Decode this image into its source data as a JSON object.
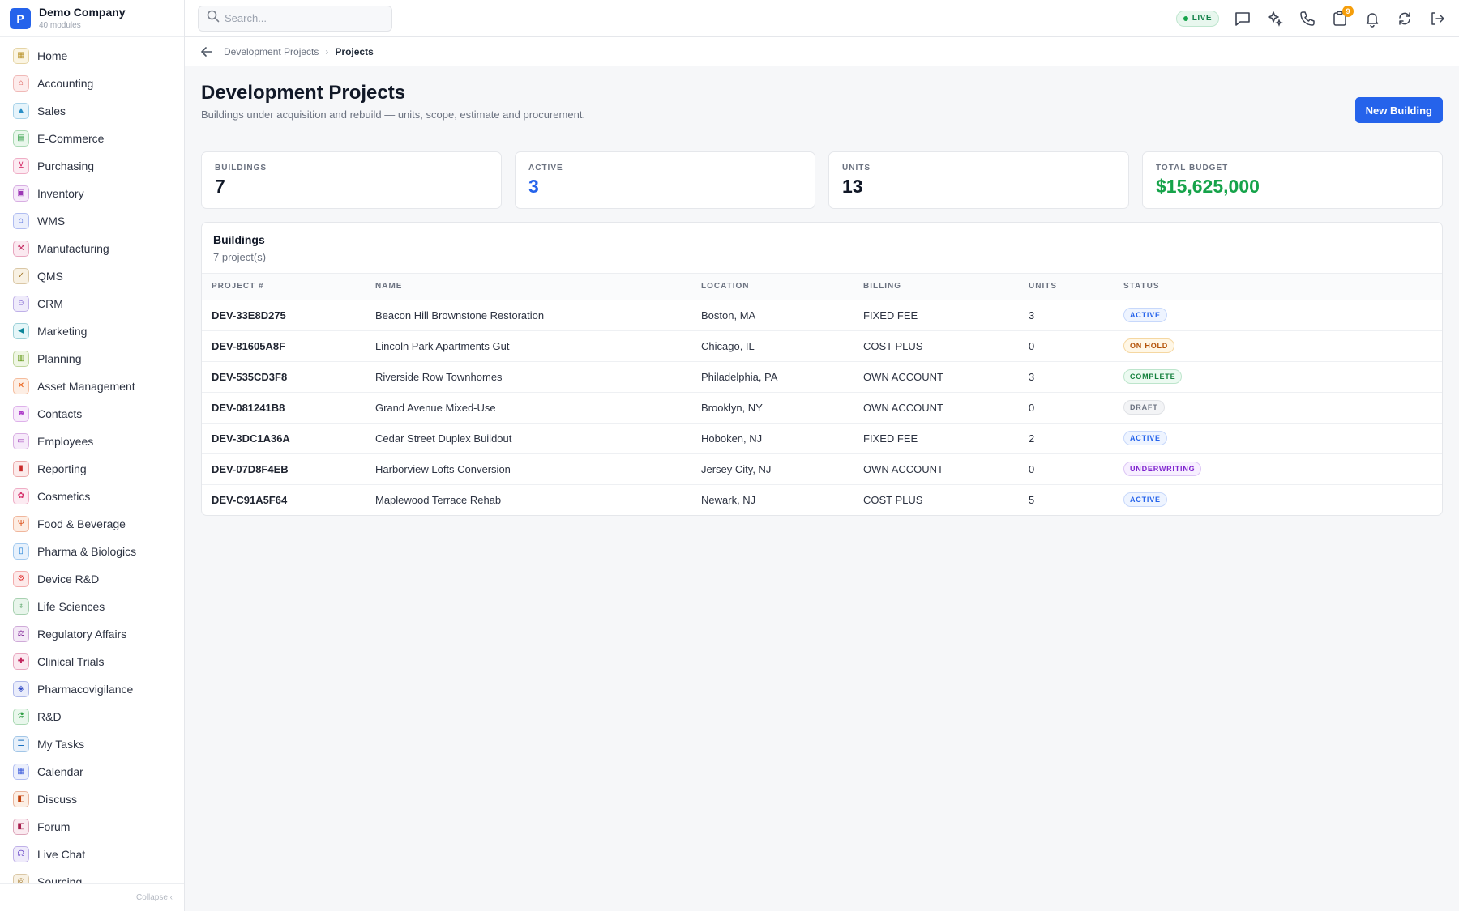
{
  "brand": {
    "logo_letter": "P",
    "name": "Demo Company",
    "subtitle": "40 modules"
  },
  "sidebar": {
    "items": [
      {
        "label": "Home",
        "icon": "grid-icon",
        "glyph": "▦",
        "color": "#b9932b",
        "bg": "#fbf5e3"
      },
      {
        "label": "Accounting",
        "icon": "bank-icon",
        "glyph": "⌂",
        "color": "#d9534f",
        "bg": "#fdecec"
      },
      {
        "label": "Sales",
        "icon": "badge-icon",
        "glyph": "▲",
        "color": "#2a8fc7",
        "bg": "#e6f4fb"
      },
      {
        "label": "E-Commerce",
        "icon": "store-icon",
        "glyph": "▤",
        "color": "#2f9e44",
        "bg": "#e9f7ec"
      },
      {
        "label": "Purchasing",
        "icon": "cart-icon",
        "glyph": "⊻",
        "color": "#d6336c",
        "bg": "#fcebf2"
      },
      {
        "label": "Inventory",
        "icon": "box-icon",
        "glyph": "▣",
        "color": "#9c36b5",
        "bg": "#f6eafa"
      },
      {
        "label": "WMS",
        "icon": "warehouse-icon",
        "glyph": "⌂",
        "color": "#3b5bdb",
        "bg": "#ebeffc"
      },
      {
        "label": "Manufacturing",
        "icon": "factory-icon",
        "glyph": "⚒",
        "color": "#c2255c",
        "bg": "#fbe9f0"
      },
      {
        "label": "QMS",
        "icon": "check-circle-icon",
        "glyph": "✓",
        "color": "#a0762a",
        "bg": "#f8f1e3"
      },
      {
        "label": "CRM",
        "icon": "users-icon",
        "glyph": "☺",
        "color": "#5f3dc4",
        "bg": "#efebfb"
      },
      {
        "label": "Marketing",
        "icon": "megaphone-icon",
        "glyph": "◀",
        "color": "#0c8599",
        "bg": "#e5f6f8"
      },
      {
        "label": "Planning",
        "icon": "clipboard-icon",
        "glyph": "▥",
        "color": "#5c940d",
        "bg": "#eff6e4"
      },
      {
        "label": "Asset Management",
        "icon": "tools-icon",
        "glyph": "✕",
        "color": "#e8590c",
        "bg": "#fdeee4"
      },
      {
        "label": "Contacts",
        "icon": "contact-card-icon",
        "glyph": "☻",
        "color": "#ae3ec9",
        "bg": "#f7ebfb"
      },
      {
        "label": "Employees",
        "icon": "briefcase-icon",
        "glyph": "▭",
        "color": "#9c36b5",
        "bg": "#f6eafa"
      },
      {
        "label": "Reporting",
        "icon": "bar-chart-icon",
        "glyph": "▮",
        "color": "#c92a2a",
        "bg": "#fcebeb"
      },
      {
        "label": "Cosmetics",
        "icon": "lotus-icon",
        "glyph": "✿",
        "color": "#d6336c",
        "bg": "#fcebf2"
      },
      {
        "label": "Food & Beverage",
        "icon": "utensils-icon",
        "glyph": "Ψ",
        "color": "#d9480f",
        "bg": "#fdede3"
      },
      {
        "label": "Pharma & Biologics",
        "icon": "pill-bottle-icon",
        "glyph": "▯",
        "color": "#1c7ed6",
        "bg": "#e7f1fc"
      },
      {
        "label": "Device R&D",
        "icon": "cog-device-icon",
        "glyph": "⚙",
        "color": "#e03131",
        "bg": "#fdeaea"
      },
      {
        "label": "Life Sciences",
        "icon": "microscope-icon",
        "glyph": "♁",
        "color": "#2b8a3e",
        "bg": "#e8f5eb"
      },
      {
        "label": "Regulatory Affairs",
        "icon": "gavel-icon",
        "glyph": "⚖",
        "color": "#862e9c",
        "bg": "#f4e9f7"
      },
      {
        "label": "Clinical Trials",
        "icon": "clinical-icon",
        "glyph": "✚",
        "color": "#c2255c",
        "bg": "#fbe9f0"
      },
      {
        "label": "Pharmacovigilance",
        "icon": "shield-icon",
        "glyph": "◈",
        "color": "#364fc7",
        "bg": "#eaedfb"
      },
      {
        "label": "R&D",
        "icon": "flask-icon",
        "glyph": "⚗",
        "color": "#2f9e44",
        "bg": "#e9f7ec"
      },
      {
        "label": "My Tasks",
        "icon": "checklist-icon",
        "glyph": "☰",
        "color": "#1971c2",
        "bg": "#e7f0fa"
      },
      {
        "label": "Calendar",
        "icon": "calendar-icon",
        "glyph": "▦",
        "color": "#3b5bdb",
        "bg": "#ebeffc"
      },
      {
        "label": "Discuss",
        "icon": "chat-bubbles-icon",
        "glyph": "◧",
        "color": "#c2410c",
        "bg": "#fcefe5"
      },
      {
        "label": "Forum",
        "icon": "forum-icon",
        "glyph": "◧",
        "color": "#a61e4d",
        "bg": "#faeaf0"
      },
      {
        "label": "Live Chat",
        "icon": "headset-icon",
        "glyph": "☊",
        "color": "#5f3dc4",
        "bg": "#efebfb"
      },
      {
        "label": "Sourcing",
        "icon": "sourcing-icon",
        "glyph": "◎",
        "color": "#a0762a",
        "bg": "#f8f1e3"
      }
    ],
    "collapse_label": "Collapse ‹"
  },
  "topbar": {
    "search_placeholder": "Search...",
    "live_label": "LIVE",
    "notification_count": "9"
  },
  "breadcrumb": {
    "parent": "Development Projects",
    "separator": "›",
    "current": "Projects"
  },
  "page": {
    "title": "Development Projects",
    "subtitle": "Buildings under acquisition and rebuild — units, scope, estimate and procurement.",
    "new_button": "New Building"
  },
  "stats": [
    {
      "label": "BUILDINGS",
      "value": "7",
      "color": "#111827"
    },
    {
      "label": "ACTIVE",
      "value": "3",
      "color": "#2563eb"
    },
    {
      "label": "UNITS",
      "value": "13",
      "color": "#111827"
    },
    {
      "label": "TOTAL BUDGET",
      "value": "$15,625,000",
      "color": "#16a34a"
    }
  ],
  "table": {
    "title": "Buildings",
    "subtitle": "7 project(s)",
    "columns": [
      "PROJECT #",
      "NAME",
      "LOCATION",
      "BILLING",
      "UNITS",
      "STATUS"
    ],
    "rows": [
      {
        "id": "DEV-33E8D275",
        "name": "Beacon Hill Brownstone Restoration",
        "location": "Boston, MA",
        "billing": "FIXED FEE",
        "units": "3",
        "status": "ACTIVE"
      },
      {
        "id": "DEV-81605A8F",
        "name": "Lincoln Park Apartments Gut",
        "location": "Chicago, IL",
        "billing": "COST PLUS",
        "units": "0",
        "status": "ON HOLD"
      },
      {
        "id": "DEV-535CD3F8",
        "name": "Riverside Row Townhomes",
        "location": "Philadelphia, PA",
        "billing": "OWN ACCOUNT",
        "units": "3",
        "status": "COMPLETE"
      },
      {
        "id": "DEV-081241B8",
        "name": "Grand Avenue Mixed-Use",
        "location": "Brooklyn, NY",
        "billing": "OWN ACCOUNT",
        "units": "0",
        "status": "DRAFT"
      },
      {
        "id": "DEV-3DC1A36A",
        "name": "Cedar Street Duplex Buildout",
        "location": "Hoboken, NJ",
        "billing": "FIXED FEE",
        "units": "2",
        "status": "ACTIVE"
      },
      {
        "id": "DEV-07D8F4EB",
        "name": "Harborview Lofts Conversion",
        "location": "Jersey City, NJ",
        "billing": "OWN ACCOUNT",
        "units": "0",
        "status": "UNDERWRITING"
      },
      {
        "id": "DEV-C91A5F64",
        "name": "Maplewood Terrace Rehab",
        "location": "Newark, NJ",
        "billing": "COST PLUS",
        "units": "5",
        "status": "ACTIVE"
      }
    ]
  },
  "status_colors": {
    "ACTIVE": {
      "fg": "#2563eb",
      "bg": "#eef4ff",
      "border": "#c7d8fb"
    },
    "ON HOLD": {
      "fg": "#b45309",
      "bg": "#fff7e6",
      "border": "#f5d7a1"
    },
    "COMPLETE": {
      "fg": "#15803d",
      "bg": "#ecfaf1",
      "border": "#bde5cc"
    },
    "DRAFT": {
      "fg": "#6b7280",
      "bg": "#f3f4f6",
      "border": "#e0e2e6"
    },
    "UNDERWRITING": {
      "fg": "#7e22ce",
      "bg": "#f7efff",
      "border": "#dcc6f5"
    }
  }
}
